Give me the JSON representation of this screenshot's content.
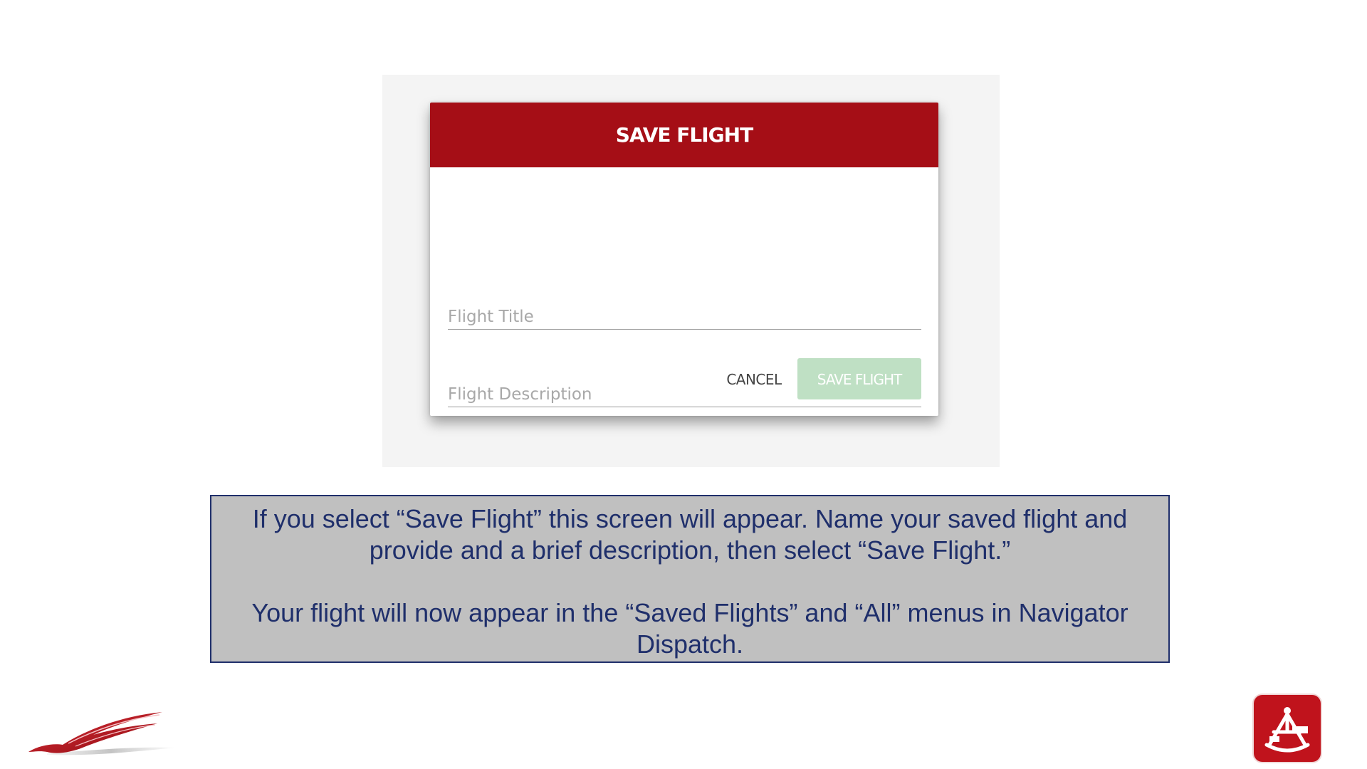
{
  "dialog": {
    "title": "SAVE FLIGHT",
    "title_placeholder": "Flight Title",
    "description_placeholder": "Flight Description",
    "cancel_label": "CANCEL",
    "save_label": "SAVE FLIGHT"
  },
  "caption": {
    "paragraph_1": "If you select “Save Flight” this screen will appear.  Name your saved flight and provide and a brief description, then select “Save Flight.”",
    "paragraph_2": "Your flight will now appear in the “Saved Flights” and “All” menus in Navigator Dispatch."
  },
  "colors": {
    "header_red": "#a50e16",
    "save_disabled_green": "#bfe0c4",
    "caption_bg": "#c0c0c0",
    "caption_text": "#1f2f6b",
    "logo_red": "#c0131c"
  },
  "icons": {
    "bottom_left": "bird-wing-logo-icon",
    "bottom_right": "sextant-app-logo-icon"
  }
}
